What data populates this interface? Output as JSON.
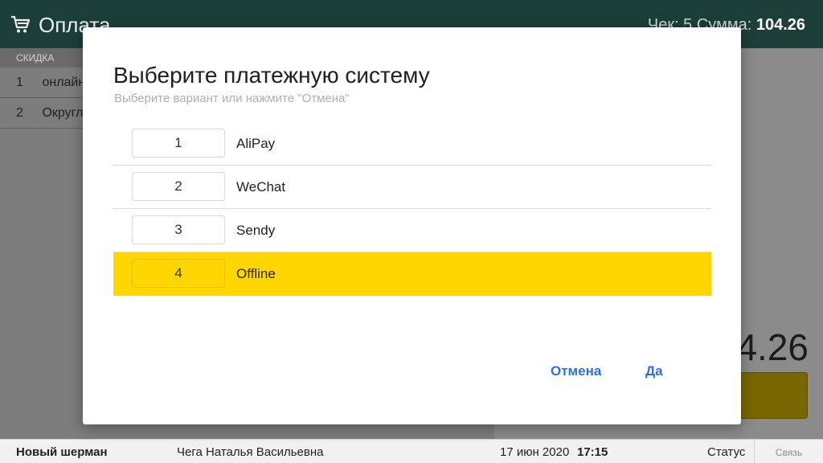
{
  "app": {
    "title": "Оплата",
    "summary_label": "Чек: 5  Сумма:",
    "summary_value": "104.26",
    "section_header": "СКИДКА",
    "rows": [
      {
        "index": "1",
        "label": "онлайн"
      },
      {
        "index": "2",
        "label": "Округл"
      }
    ],
    "total_display": "4.26"
  },
  "dialog": {
    "title": "Выберите платежную систему",
    "subtitle": "Выберите вариант или нажмите \"Отмена\"",
    "options": [
      {
        "number": "1",
        "label": "AliPay",
        "selected": false
      },
      {
        "number": "2",
        "label": "WeChat",
        "selected": false
      },
      {
        "number": "3",
        "label": "Sendy",
        "selected": false
      },
      {
        "number": "4",
        "label": "Offline",
        "selected": true
      }
    ],
    "cancel_label": "Отмена",
    "ok_label": "Да"
  },
  "statusbar": {
    "store": "Новый шерман",
    "cashier": "Чега Наталья Васильевна",
    "date": "17 июн 2020",
    "time": "17:15",
    "status": "Статус",
    "link": "Связь"
  },
  "colors": {
    "topbar": "#1c3f3a",
    "selected_row": "#ffd600",
    "button_text": "#2f6fde",
    "pay_button": "#7a6600"
  },
  "icons": {
    "cart": "cart-icon"
  }
}
